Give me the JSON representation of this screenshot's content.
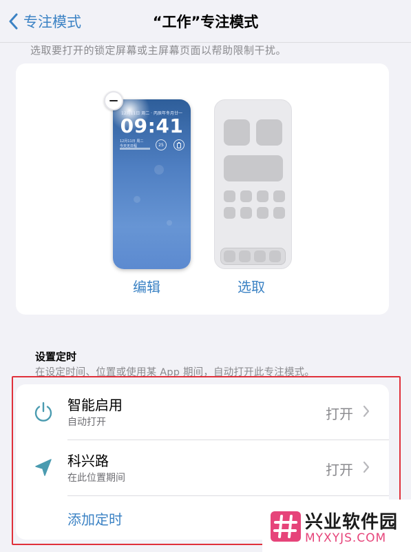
{
  "nav": {
    "back_label": "专注模式",
    "title": "“工作”专注模式"
  },
  "top_description": "选取要打开的锁定屏幕或主屏幕页面以帮助限制干扰。",
  "lock_screen": {
    "date_line": "12月11日 周二 · 丙辰年冬月廿一",
    "time": "09:41",
    "widget_line_1": "12月11日 周二",
    "widget_line_2": "今天无日程",
    "ring_1_value": "25",
    "edit_label": "编辑"
  },
  "home_screen": {
    "select_label": "选取"
  },
  "schedule": {
    "section_title": "设置定时",
    "section_description": "在设定时间、位置或使用某 App 期间，自动打开此专注模式。",
    "items": [
      {
        "title": "智能启用",
        "subtitle": "自动打开",
        "value": "打开",
        "icon": "power-icon"
      },
      {
        "title": "科兴路",
        "subtitle": "在此位置期间",
        "value": "打开",
        "icon": "location-arrow-icon"
      }
    ],
    "add_label": "添加定时"
  },
  "watermark": {
    "cn": "兴业软件园",
    "en": "MYXYJS.COM"
  },
  "colors": {
    "accent": "#3b82c4",
    "icon_teal": "#4a9bb0",
    "highlight_border": "#e0303a",
    "watermark_pink": "#e6447a"
  }
}
